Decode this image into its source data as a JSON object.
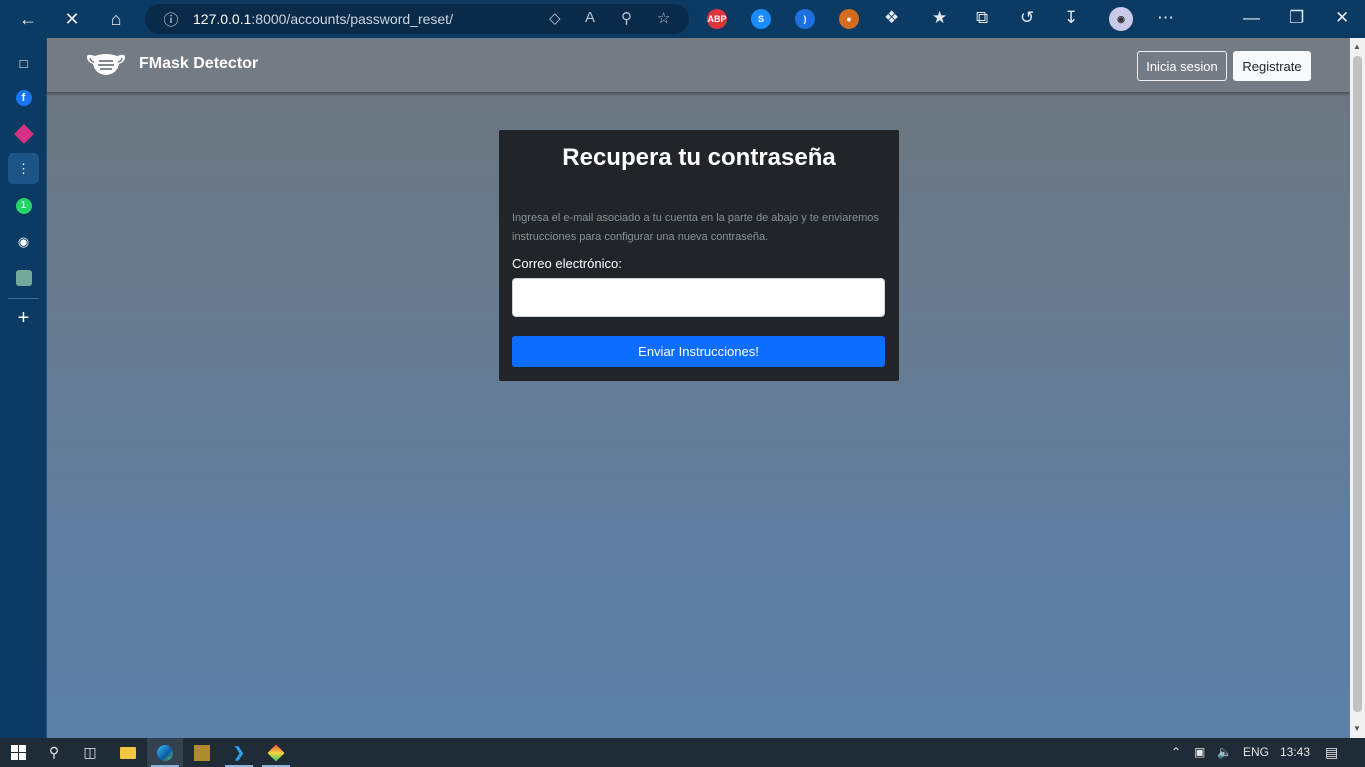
{
  "browser": {
    "url_host": "127.0.0.1",
    "url_rest": ":8000/accounts/password_reset/",
    "extensions": [
      "ABP"
    ]
  },
  "navbar": {
    "brand": "FMask Detector",
    "login_label": "Inicia sesion",
    "register_label": "Registrate"
  },
  "card": {
    "title": "Recupera tu contraseña",
    "description": "Ingresa el e-mail asociado a tu cuenta en la parte de abajo y te enviaremos instrucciones para configurar una nueva contraseña.",
    "email_label": "Correo electrónico:",
    "email_value": "",
    "submit_label": "Enviar Instrucciones!"
  },
  "taskbar": {
    "language": "ENG",
    "time": "13:43"
  },
  "colors": {
    "primary": "#0d6efd",
    "card_bg": "#212529",
    "browser_chrome": "#0b3a63"
  }
}
